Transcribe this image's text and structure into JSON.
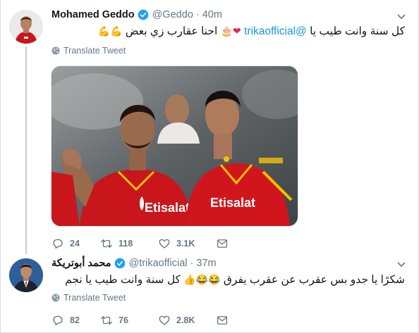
{
  "tweet1": {
    "name": "Mohamed Geddo",
    "handle": "@Geddo",
    "time": "40m",
    "text_main": "كل سنة وانت طيب يا",
    "mention": "@trikaofficial",
    "text_tail": "احنا عقارب زي بعض",
    "translate_label": "Translate Tweet",
    "replies": "24",
    "retweets": "118",
    "likes": "3.1K"
  },
  "tweet2": {
    "name": "محمد أبوتريكة",
    "handle": "@trikaofficial",
    "time": "37m",
    "text_main": "شكرًا يا جدو بس عقرب عن عقرب يفرق",
    "text_tail": "كل سنة وانت طيب يا نجم",
    "translate_label": "Translate Tweet",
    "replies": "82",
    "retweets": "76",
    "likes": "2.8K"
  },
  "colors": {
    "accent": "#1da1f2",
    "link": "#1b95e0",
    "muted": "#657786",
    "jersey_red": "#d0161c"
  },
  "icons": [
    "verified-badge-icon",
    "caret-down-icon",
    "globe-icon",
    "reply-icon",
    "retweet-icon",
    "like-icon",
    "direct-message-icon"
  ]
}
